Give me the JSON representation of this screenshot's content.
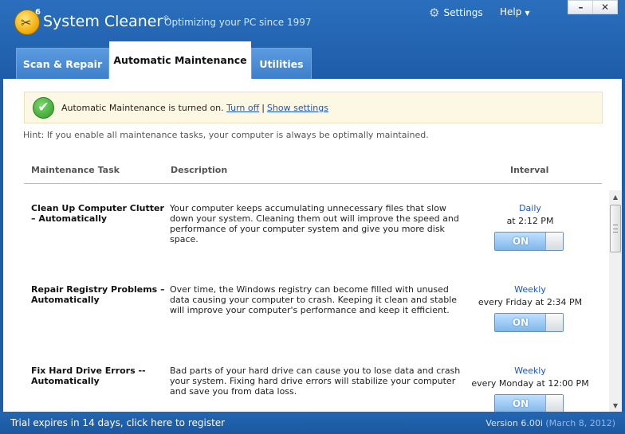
{
  "header": {
    "app_title": "System Cleaner",
    "trademark": "©",
    "logo_badge": "6",
    "tagline": "Optimizing your PC since 1997",
    "settings_label": "Settings",
    "help_label": "Help",
    "minimize_glyph": "–",
    "close_glyph": "✕"
  },
  "tabs": [
    {
      "label": "Scan & Repair",
      "active": false
    },
    {
      "label": "Automatic Maintenance",
      "active": true
    },
    {
      "label": "Utilities",
      "active": false
    }
  ],
  "notice": {
    "status_text": "Automatic Maintenance is turned on.",
    "turn_off_link": "Turn off",
    "separator": "|",
    "show_settings_link": "Show settings"
  },
  "hint": "Hint: If you enable all maintenance tasks, your computer is always be optimally maintained.",
  "columns": {
    "task": "Maintenance Task",
    "description": "Description",
    "interval": "Interval"
  },
  "tasks": [
    {
      "name": "Clean Up Computer Clutter – Automatically",
      "description": "Your computer keeps accumulating unnecessary files that slow down your system. Cleaning them out will improve the speed and performance of your computer system and give you more disk space.",
      "frequency": "Daily",
      "schedule": "at 2:12 PM",
      "toggle": "ON"
    },
    {
      "name": "Repair Registry Problems – Automatically",
      "description": "Over time, the Windows registry can become filled with unused data causing your computer to crash. Keeping it clean and stable will improve your computer's performance and keep it efficient.",
      "frequency": "Weekly",
      "schedule": "every Friday at 2:34 PM",
      "toggle": "ON"
    },
    {
      "name": "Fix Hard Drive Errors -- Automatically",
      "description": "Bad parts of your hard drive can cause you to lose data and crash your system. Fixing hard drive errors will stabilize your computer and save you from data loss.",
      "frequency": "Weekly",
      "schedule": "every Monday at 12:00 PM",
      "toggle": "ON"
    }
  ],
  "footer": {
    "trial_text": "Trial expires in 14 days, click here to register",
    "version": "Version 6.00i",
    "release_date": "(March 8, 2012)"
  },
  "colors": {
    "header_blue": "#1e5ca8",
    "link_blue": "#1b55c2",
    "notice_bg": "#fdf8e4",
    "toggle_on": "#7fb7ea"
  },
  "icons": {
    "logo": "logo-icon",
    "settings": "gear-icon",
    "status": "checkmark-icon"
  }
}
